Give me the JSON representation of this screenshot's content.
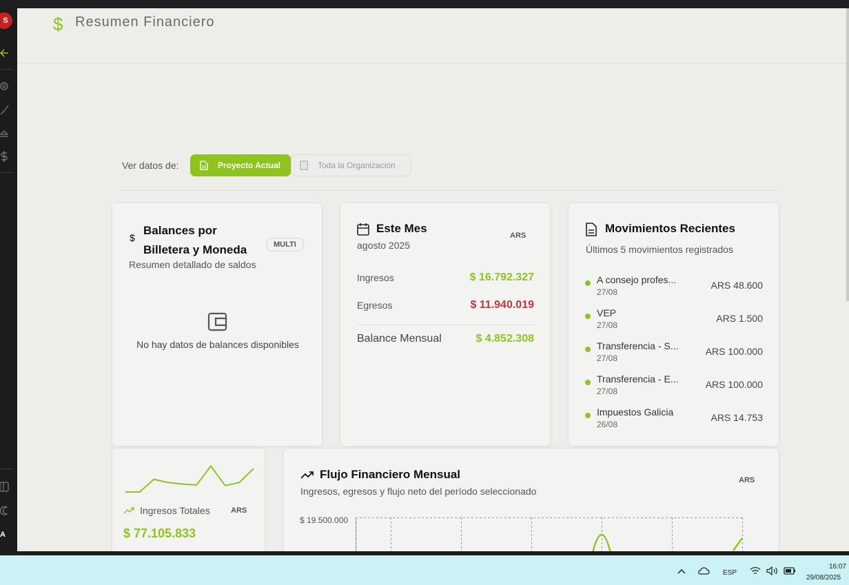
{
  "rail": {
    "avatar": "S",
    "bottom_letter": "A"
  },
  "header": {
    "title": "Resumen Financiero"
  },
  "view_toggle": {
    "label": "Ver datos de:",
    "active": "Proyecto Actual",
    "inactive": "Toda la Organización"
  },
  "balances": {
    "title_line1": "Balances por",
    "title_line2": "Billetera y Moneda",
    "badge": "MULTI",
    "subtitle": "Resumen detallado de saldos",
    "empty": "No hay datos de balances disponibles"
  },
  "month": {
    "title": "Este Mes",
    "period": "agosto 2025",
    "currency": "ARS",
    "income_label": "Ingresos",
    "income_value": "$ 16.792.327",
    "expense_label": "Egresos",
    "expense_value": "$ 11.940.019",
    "balance_label": "Balance Mensual",
    "balance_value": "$ 4.852.308"
  },
  "movements": {
    "title": "Movimientos Recientes",
    "subtitle": "Últimos 5 movimientos registrados",
    "items": [
      {
        "name": "A consejo profes...",
        "date": "27/08",
        "amount": "ARS 48.600"
      },
      {
        "name": "VEP",
        "date": "27/08",
        "amount": "ARS 1.500"
      },
      {
        "name": "Transferencia - S...",
        "date": "27/08",
        "amount": "ARS 100.000"
      },
      {
        "name": "Transferencia - E...",
        "date": "27/08",
        "amount": "ARS 100.000"
      },
      {
        "name": "Impuestos Galicia",
        "date": "26/08",
        "amount": "ARS 14.753"
      }
    ]
  },
  "totals": {
    "label": "Ingresos Totales",
    "currency": "ARS",
    "value": "$ 77.105.833",
    "sparkline": [
      0,
      0,
      0.4,
      0.3,
      0.25,
      0.22,
      0.82,
      0.2,
      0.3,
      0.74
    ]
  },
  "flow": {
    "title": "Flujo Financiero Mensual",
    "subtitle": "Ingresos, egresos y flujo neto del período seleccionado",
    "currency": "ARS",
    "y_tick": "$ 19.500.000"
  },
  "taskbar": {
    "lang": "ESP",
    "time": "16:07",
    "date": "29/08/2025"
  },
  "colors": {
    "accent": "#8fc31f",
    "negative": "#c0383a"
  }
}
